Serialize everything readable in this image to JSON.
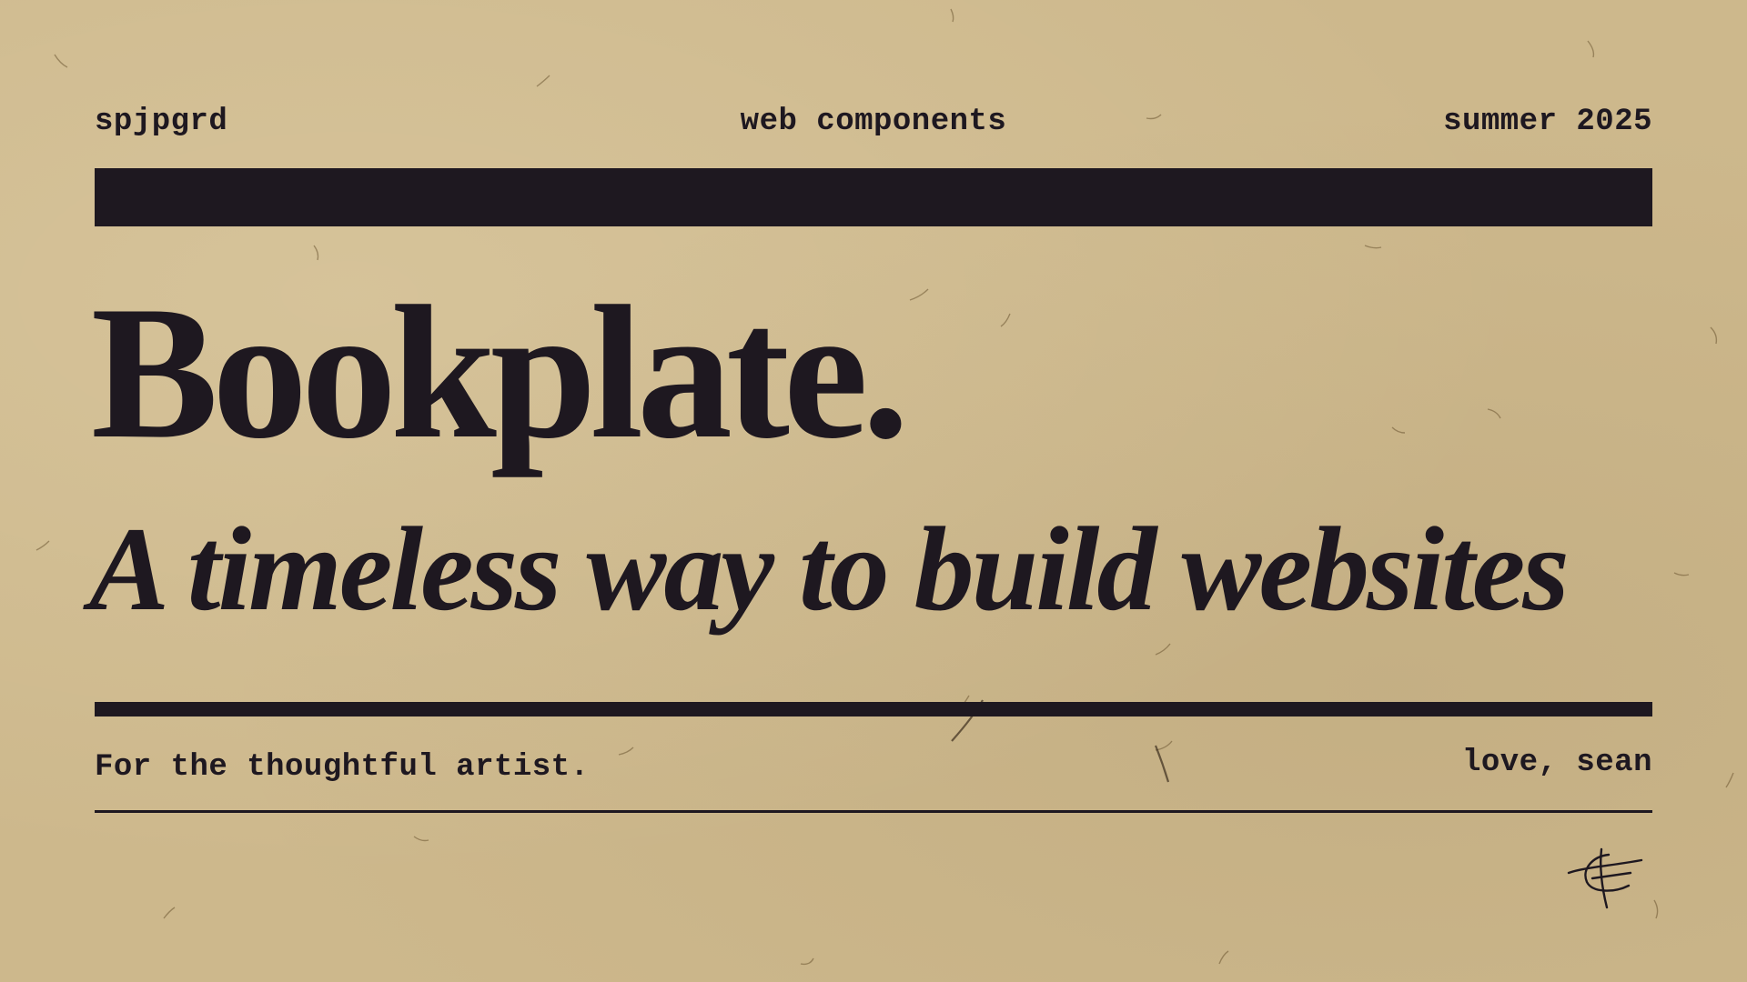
{
  "header": {
    "left": "spjpgrd",
    "center": "web components",
    "right": "summer 2025"
  },
  "main": {
    "title": "Bookplate.",
    "subtitle": "A timeless way to build websites"
  },
  "footer": {
    "left": "For the thoughtful artist.",
    "right": "love, sean"
  },
  "colors": {
    "paper": "#cdb88c",
    "ink": "#1e1820"
  },
  "icons": {
    "monogram": "handwritten-signature-monogram"
  }
}
